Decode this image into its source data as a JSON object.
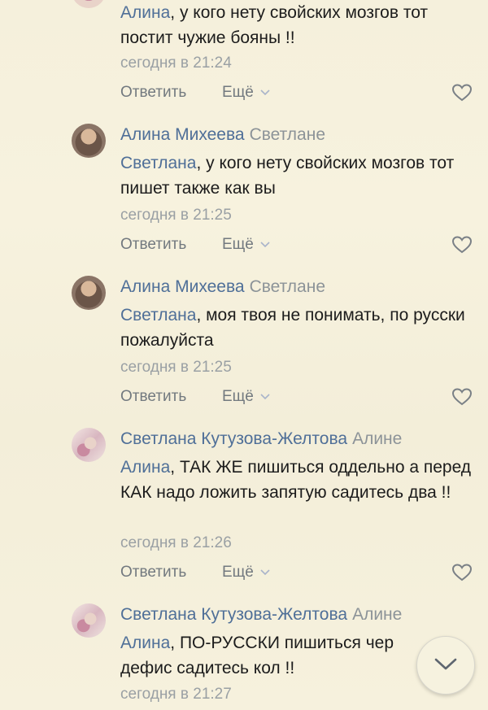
{
  "comments": [
    {
      "author": "",
      "reply_to": "",
      "mention": "Алина",
      "text": ", у кого нету свойских мозгов тот постит чужие бояны !!",
      "time": "сегодня в 21:24",
      "reply_label": "Ответить",
      "more_label": "Ещё"
    },
    {
      "author": "Алина Михеева",
      "reply_to": "Светлане",
      "mention": "Светлана",
      "text": ", у кого нету свойских мозгов тот пишет также как вы",
      "time": "сегодня в 21:25",
      "reply_label": "Ответить",
      "more_label": "Ещё"
    },
    {
      "author": "Алина Михеева",
      "reply_to": "Светлане",
      "mention": "Светлана",
      "text": ", моя твоя не понимать, по русски пожалуйста",
      "time": "сегодня в 21:25",
      "reply_label": "Ответить",
      "more_label": "Ещё"
    },
    {
      "author": "Светлана Кутузова-Желтова",
      "reply_to": "Алине",
      "mention": "Алина",
      "text": ", ТАК ЖЕ пишиться оддельно а перед КАК надо ложить запятую садитесь два !!",
      "time": "сегодня в 21:26",
      "reply_label": "Ответить",
      "more_label": "Ещё"
    },
    {
      "author": "Светлана Кутузова-Желтова",
      "reply_to": "Алине",
      "mention": "Алина",
      "text": ", ПО-РУССКИ пишиться чер",
      "text_line2": "дефис садитесь кол !!",
      "time": "сегодня в 21:27"
    }
  ],
  "icons": {
    "like": "heart-outline-icon",
    "more_chevron": "chevron-down-icon",
    "scroll": "chevron-down-icon"
  },
  "colors": {
    "background": "#f5f0dc",
    "link": "#4f6f98",
    "muted": "#9aa0a4",
    "text": "#1c1c1c"
  }
}
